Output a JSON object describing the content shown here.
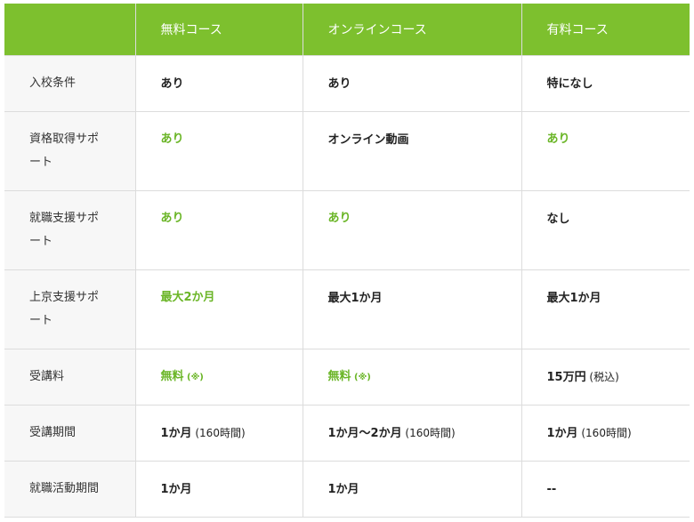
{
  "table": {
    "headers": [
      "",
      "無料コース",
      "オンラインコース",
      "有料コース"
    ],
    "rows": [
      {
        "label": "入校条件",
        "cells": [
          {
            "main": "あり",
            "note": "",
            "highlight": false
          },
          {
            "main": "あり",
            "note": "",
            "highlight": false
          },
          {
            "main": "特になし",
            "note": "",
            "highlight": false
          }
        ]
      },
      {
        "label": "資格取得サポート",
        "cells": [
          {
            "main": "あり",
            "note": "",
            "highlight": true
          },
          {
            "main": "オンライン動画",
            "note": "",
            "highlight": false
          },
          {
            "main": "あり",
            "note": "",
            "highlight": true
          }
        ]
      },
      {
        "label": "就職支援サポート",
        "cells": [
          {
            "main": "あり",
            "note": "",
            "highlight": true
          },
          {
            "main": "あり",
            "note": "",
            "highlight": true
          },
          {
            "main": "なし",
            "note": "",
            "highlight": false
          }
        ]
      },
      {
        "label": "上京支援サポート",
        "cells": [
          {
            "main": "最大2か月",
            "note": "",
            "highlight": true
          },
          {
            "main": "最大1か月",
            "note": "",
            "highlight": false
          },
          {
            "main": "最大1か月",
            "note": "",
            "highlight": false
          }
        ]
      },
      {
        "label": "受講料",
        "cells": [
          {
            "main": "無料",
            "note": " (※)",
            "highlight": true
          },
          {
            "main": "無料",
            "note": " (※)",
            "highlight": true
          },
          {
            "main": "15万円",
            "note": " (税込)",
            "highlight": false
          }
        ]
      },
      {
        "label": "受講期間",
        "cells": [
          {
            "main": "1か月",
            "note": " (160時間)",
            "highlight": false
          },
          {
            "main": "1か月〜2か月",
            "note": " (160時間)",
            "highlight": false
          },
          {
            "main": "1か月",
            "note": " (160時間)",
            "highlight": false
          }
        ]
      },
      {
        "label": "就職活動期間",
        "cells": [
          {
            "main": "1か月",
            "note": "",
            "highlight": false
          },
          {
            "main": "1か月",
            "note": "",
            "highlight": false
          },
          {
            "main": "--",
            "note": "",
            "highlight": false
          }
        ]
      }
    ]
  },
  "colors": {
    "header_bg": "#7dc02e",
    "highlight_text": "#6ab526",
    "label_bg": "#f7f7f7",
    "border": "#dcdcdc"
  }
}
